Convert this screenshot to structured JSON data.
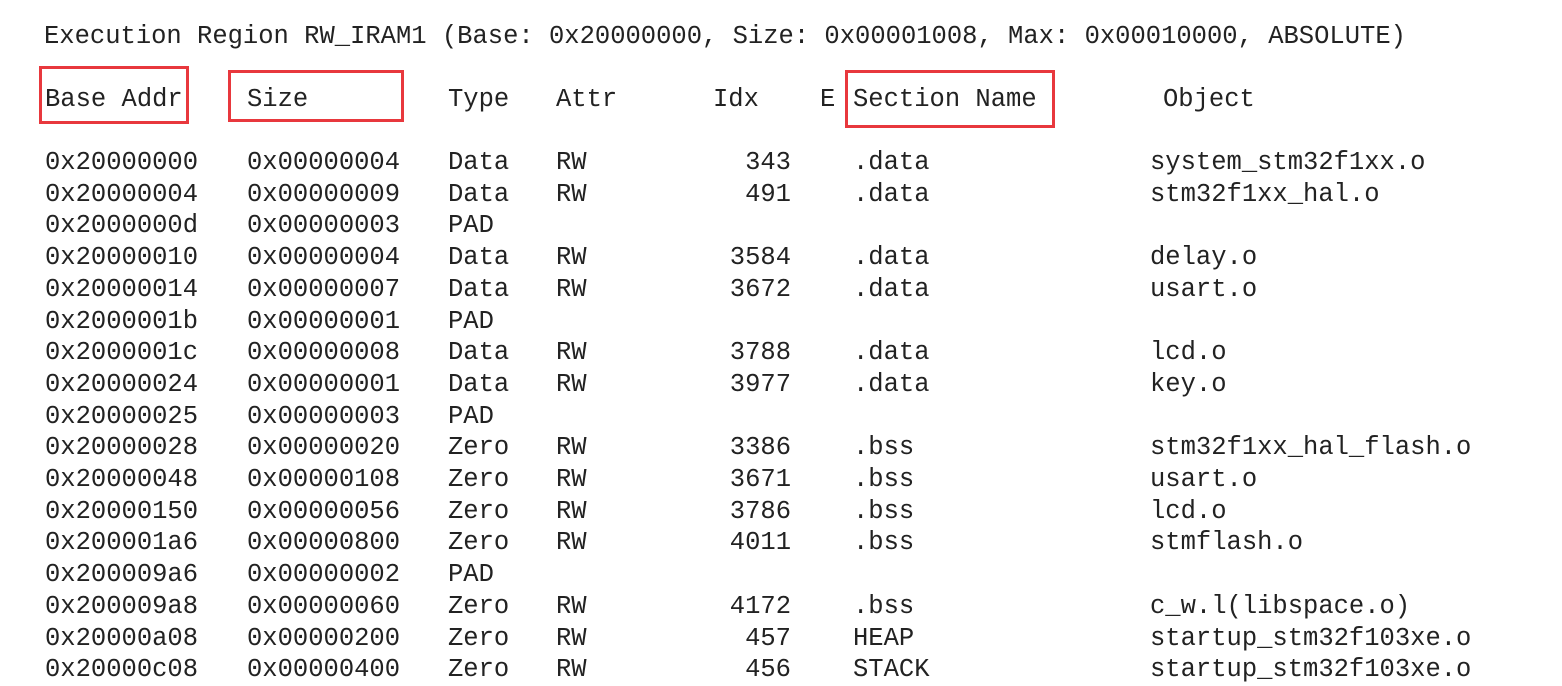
{
  "title": "Execution Region RW_IRAM1 (Base: 0x20000000, Size: 0x00001008, Max: 0x00010000, ABSOLUTE)",
  "highlight_color": "#e8383d",
  "columns": {
    "base": "Base Addr",
    "size": "Size",
    "type": "Type",
    "attr": "Attr",
    "idx": "Idx",
    "e": "E",
    "section": "Section Name",
    "object": "Object"
  },
  "highlighted_columns": [
    "Base Addr",
    "Size",
    "Section Name"
  ],
  "rows": [
    {
      "base": "0x20000000",
      "size": "0x00000004",
      "type": "Data",
      "attr": "RW",
      "idx": "343",
      "section": ".data",
      "object": "system_stm32f1xx.o"
    },
    {
      "base": "0x20000004",
      "size": "0x00000009",
      "type": "Data",
      "attr": "RW",
      "idx": "491",
      "section": ".data",
      "object": "stm32f1xx_hal.o"
    },
    {
      "base": "0x2000000d",
      "size": "0x00000003",
      "type": "PAD",
      "attr": "",
      "idx": "",
      "section": "",
      "object": ""
    },
    {
      "base": "0x20000010",
      "size": "0x00000004",
      "type": "Data",
      "attr": "RW",
      "idx": "3584",
      "section": ".data",
      "object": "delay.o"
    },
    {
      "base": "0x20000014",
      "size": "0x00000007",
      "type": "Data",
      "attr": "RW",
      "idx": "3672",
      "section": ".data",
      "object": "usart.o"
    },
    {
      "base": "0x2000001b",
      "size": "0x00000001",
      "type": "PAD",
      "attr": "",
      "idx": "",
      "section": "",
      "object": ""
    },
    {
      "base": "0x2000001c",
      "size": "0x00000008",
      "type": "Data",
      "attr": "RW",
      "idx": "3788",
      "section": ".data",
      "object": "lcd.o"
    },
    {
      "base": "0x20000024",
      "size": "0x00000001",
      "type": "Data",
      "attr": "RW",
      "idx": "3977",
      "section": ".data",
      "object": "key.o"
    },
    {
      "base": "0x20000025",
      "size": "0x00000003",
      "type": "PAD",
      "attr": "",
      "idx": "",
      "section": "",
      "object": ""
    },
    {
      "base": "0x20000028",
      "size": "0x00000020",
      "type": "Zero",
      "attr": "RW",
      "idx": "3386",
      "section": ".bss",
      "object": "stm32f1xx_hal_flash.o"
    },
    {
      "base": "0x20000048",
      "size": "0x00000108",
      "type": "Zero",
      "attr": "RW",
      "idx": "3671",
      "section": ".bss",
      "object": "usart.o"
    },
    {
      "base": "0x20000150",
      "size": "0x00000056",
      "type": "Zero",
      "attr": "RW",
      "idx": "3786",
      "section": ".bss",
      "object": "lcd.o"
    },
    {
      "base": "0x200001a6",
      "size": "0x00000800",
      "type": "Zero",
      "attr": "RW",
      "idx": "4011",
      "section": ".bss",
      "object": "stmflash.o"
    },
    {
      "base": "0x200009a6",
      "size": "0x00000002",
      "type": "PAD",
      "attr": "",
      "idx": "",
      "section": "",
      "object": ""
    },
    {
      "base": "0x200009a8",
      "size": "0x00000060",
      "type": "Zero",
      "attr": "RW",
      "idx": "4172",
      "section": ".bss",
      "object": "c_w.l(libspace.o)"
    },
    {
      "base": "0x20000a08",
      "size": "0x00000200",
      "type": "Zero",
      "attr": "RW",
      "idx": "457",
      "section": "HEAP",
      "object": "startup_stm32f103xe.o"
    },
    {
      "base": "0x20000c08",
      "size": "0x00000400",
      "type": "Zero",
      "attr": "RW",
      "idx": "456",
      "section": "STACK",
      "object": "startup_stm32f103xe.o"
    }
  ]
}
